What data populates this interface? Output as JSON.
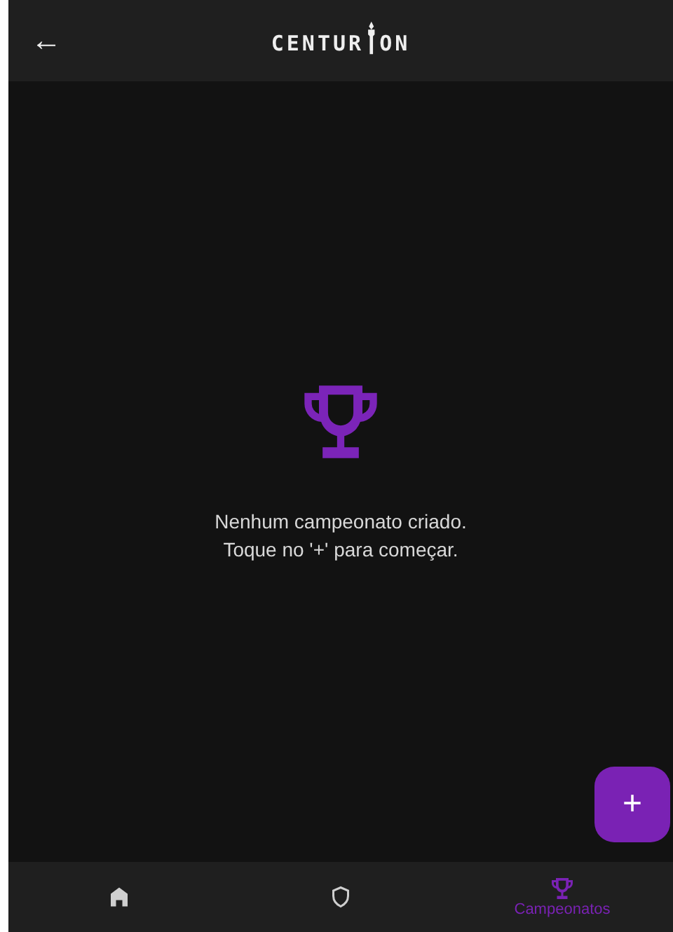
{
  "app_bar": {
    "back_button": "←",
    "logo": {
      "before_torch": "CENTUR",
      "after_torch": "ON"
    }
  },
  "empty_state": {
    "lines": [
      "Nenhum campeonato criado.",
      "Toque no '+' para começar."
    ]
  },
  "fab": {
    "label": "+"
  },
  "bottom_nav": [
    {
      "kind": "home",
      "selected": false
    },
    {
      "kind": "shield",
      "selected": false
    },
    {
      "kind": "trophy",
      "label": "Campeonatos",
      "selected": true
    }
  ]
}
